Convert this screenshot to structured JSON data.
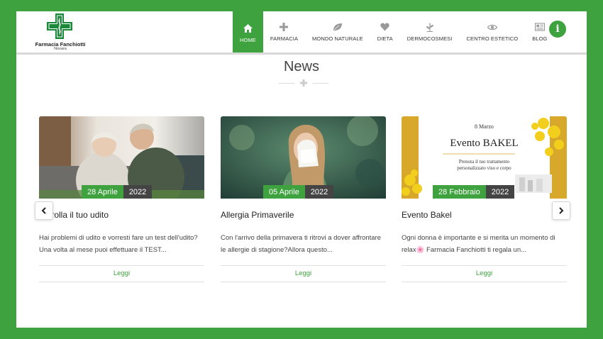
{
  "brand": {
    "name": "Farmacia Fanchiotti",
    "city": "Novara",
    "accent": "#3ea33e"
  },
  "nav": {
    "items": [
      {
        "label": "HOME",
        "icon": "home-icon",
        "active": true
      },
      {
        "label": "FARMACIA",
        "icon": "plus-icon"
      },
      {
        "label": "MONDO NATURALE",
        "icon": "leaf-icon"
      },
      {
        "label": "DIETA",
        "icon": "heart-icon"
      },
      {
        "label": "DERMOCOSMESI",
        "icon": "plant-icon"
      },
      {
        "label": "CENTRO ESTETICO",
        "icon": "eye-icon"
      },
      {
        "label": "BLOG",
        "icon": "newspaper-icon"
      }
    ],
    "info_icon": "info-icon",
    "info_glyph": "i"
  },
  "news": {
    "title": "News",
    "cards": [
      {
        "day": "28 Aprile",
        "year": "2022",
        "title": "Controlla il tuo udito",
        "text": "Hai problemi di udito e vorresti fare un test dell'udito? Una volta al mese puoi effettuare il TEST...",
        "read": "Leggi"
      },
      {
        "day": "05 Aprile",
        "year": "2022",
        "title": "Allergia Primaverile",
        "text": "Con l'arrivo della primavera ti ritrovi a dover affrontare le allergie di stagione?Allora questo...",
        "read": "Leggi"
      },
      {
        "day": "28 Febbraio",
        "year": "2022",
        "title": "Evento Bakel",
        "text": "Ogni donna è importante e si merita un momento di relax🌸 Farmacia Fanchiotti ti regala un...",
        "read": "Leggi",
        "poster": {
          "date": "8 Marzo",
          "headline": "Evento BAKEL",
          "line1": "Prenota il tuo trattamento",
          "line2": "personalizzato viso e corpo"
        }
      }
    ],
    "prev_icon": "chevron-left-icon",
    "next_icon": "chevron-right-icon"
  }
}
